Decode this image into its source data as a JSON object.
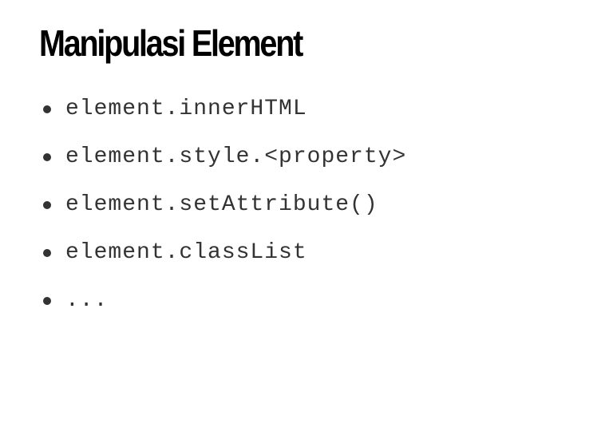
{
  "slide": {
    "title": "Manipulasi Element",
    "bullets": [
      {
        "text": "element.innerHTML"
      },
      {
        "text": "element.style.<property>"
      },
      {
        "text": "element.setAttribute()"
      },
      {
        "text": "element.classList"
      },
      {
        "text": "..."
      }
    ]
  },
  "colors": {
    "background": "#ffffff",
    "title": "#000000",
    "body_text": "#333333"
  }
}
